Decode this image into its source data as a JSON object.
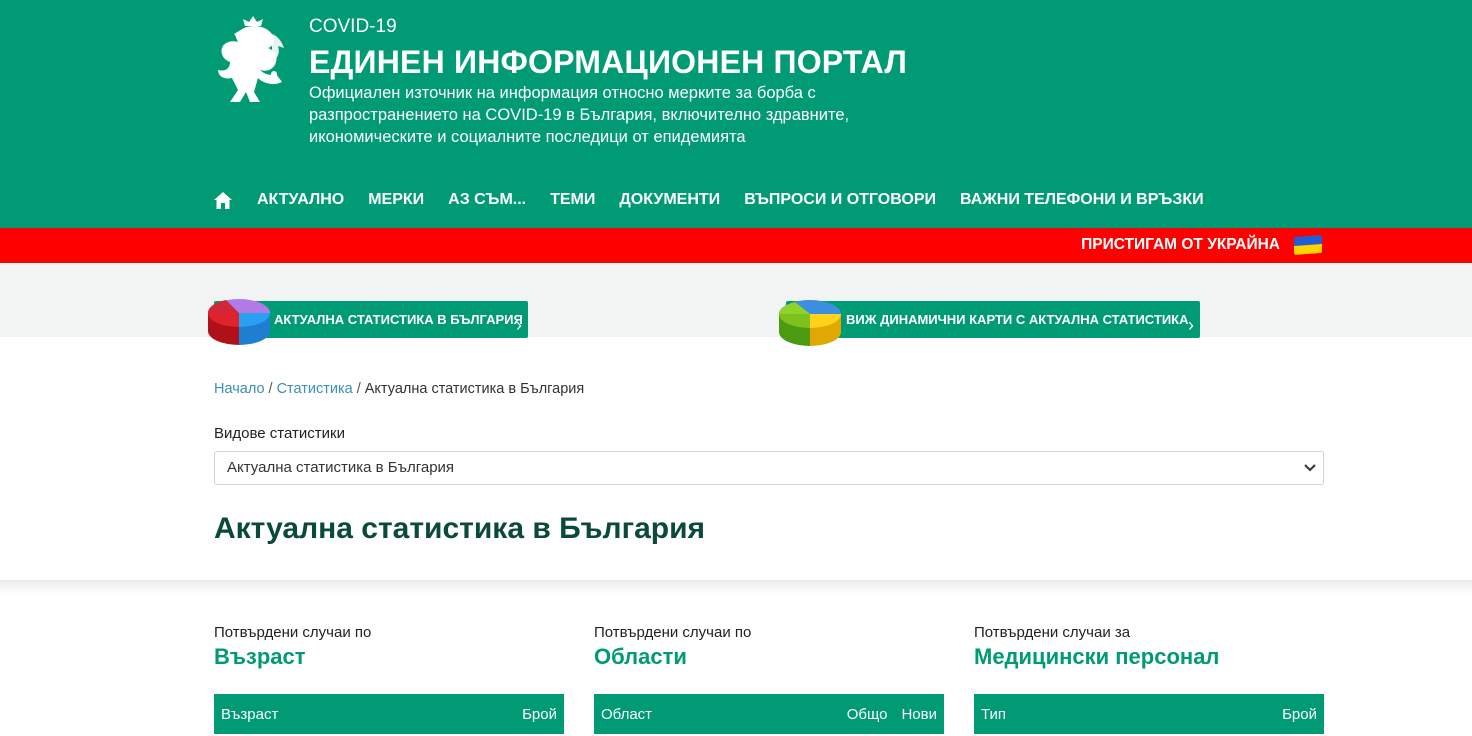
{
  "header": {
    "kicker": "COVID-19",
    "title": "ЕДИНЕН ИНФОРМАЦИОНЕН ПОРТАЛ",
    "description": "Официален източник на информация относно мерките за борба с разпространението на COVID-19 в България, включително здравните, икономическите и социалните последици от епидемията",
    "colors": {
      "primary": "#009a75",
      "alert": "#ff0000",
      "title": "#0b4a3a"
    }
  },
  "nav": {
    "home_icon": "home-icon",
    "items": [
      "АКТУАЛНО",
      "МЕРКИ",
      "АЗ СЪМ...",
      "ТЕМИ",
      "ДОКУМЕНТИ",
      "ВЪПРОСИ И ОТГОВОРИ",
      "ВАЖНИ ТЕЛЕФОНИ И ВРЪЗКИ"
    ]
  },
  "ukraine": {
    "label": "ПРИСТИГАМ ОТ УКРАЙНА"
  },
  "stats_buttons": [
    {
      "label": "АКТУАЛНА СТАТИСТИКА В БЪЛГАРИЯ"
    },
    {
      "label": "ВИЖ ДИНАМИЧНИ КАРТИ С АКТУАЛНА СТАТИСТИКА"
    }
  ],
  "breadcrumb": {
    "home": "Начало",
    "section": "Статистика",
    "current": "Актуална статистика в България",
    "separator": "/"
  },
  "select": {
    "label": "Видове статистики",
    "value": "Актуална статистика в България"
  },
  "page_title": "Актуална статистика в България",
  "cards": [
    {
      "subtitle": "Потвърдени случаи по",
      "title": "Възраст",
      "columns": [
        "Възраст",
        "Брой"
      ]
    },
    {
      "subtitle": "Потвърдени случаи по",
      "title": "Области",
      "columns": [
        "Област",
        "Общо",
        "Нови"
      ]
    },
    {
      "subtitle": "Потвърдени случаи за",
      "title": "Медицински персонал",
      "columns": [
        "Тип",
        "Брой"
      ]
    }
  ]
}
